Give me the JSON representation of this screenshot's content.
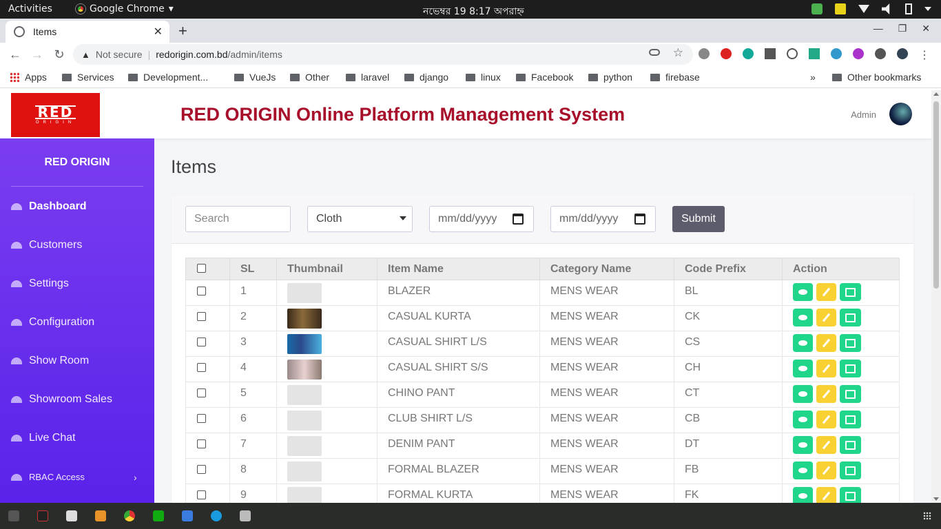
{
  "os": {
    "activities": "Activities",
    "app_menu": "Google Chrome",
    "clock": "নভেম্বর 19   8:17 অপরাহ্ন"
  },
  "browser": {
    "tab_title": "Items",
    "not_secure": "Not secure",
    "url_host": "redorigin.com.bd",
    "url_path": "/admin/items",
    "bookmarks": {
      "apps": "Apps",
      "items": [
        "Services",
        "Development...",
        "VueJs",
        "Other",
        "laravel",
        "django",
        "linux",
        "Facebook",
        "python",
        "firebase"
      ],
      "other": "Other bookmarks",
      "overflow": "»"
    }
  },
  "header": {
    "logo_main": "RED",
    "logo_sub": "ORIGIN",
    "title": "RED ORIGIN Online Platform Management System",
    "user": "Admin"
  },
  "sidebar": {
    "title": "RED ORIGIN",
    "items": [
      {
        "label": "Dashboard"
      },
      {
        "label": "Customers"
      },
      {
        "label": "Settings"
      },
      {
        "label": "Configuration"
      },
      {
        "label": "Show Room"
      },
      {
        "label": "Showroom Sales"
      },
      {
        "label": "Live Chat"
      },
      {
        "label": "RBAC Access"
      }
    ],
    "arrow": "›"
  },
  "main": {
    "page_title": "Items",
    "filters": {
      "search_placeholder": "Search",
      "category_selected": "Cloth",
      "date_from_placeholder": "mm/dd/yyyy",
      "date_to_placeholder": "mm/dd/yyyy",
      "submit_label": "Submit"
    },
    "table": {
      "headers": [
        "SL",
        "Thumbnail",
        "Item Name",
        "Category Name",
        "Code Prefix",
        "Action"
      ],
      "rows": [
        {
          "sl": "1",
          "thumb": "placeholder",
          "name": "BLAZER",
          "category": "MENS WEAR",
          "code": "BL"
        },
        {
          "sl": "2",
          "thumb": "person1",
          "name": "CASUAL KURTA",
          "category": "MENS WEAR",
          "code": "CK"
        },
        {
          "sl": "3",
          "thumb": "person2",
          "name": "CASUAL SHIRT L/S",
          "category": "MENS WEAR",
          "code": "CS"
        },
        {
          "sl": "4",
          "thumb": "person3",
          "name": "CASUAL SHIRT S/S",
          "category": "MENS WEAR",
          "code": "CH"
        },
        {
          "sl": "5",
          "thumb": "placeholder",
          "name": "CHINO PANT",
          "category": "MENS WEAR",
          "code": "CT"
        },
        {
          "sl": "6",
          "thumb": "placeholder",
          "name": "CLUB SHIRT L/S",
          "category": "MENS WEAR",
          "code": "CB"
        },
        {
          "sl": "7",
          "thumb": "placeholder",
          "name": "DENIM PANT",
          "category": "MENS WEAR",
          "code": "DT"
        },
        {
          "sl": "8",
          "thumb": "placeholder",
          "name": "FORMAL BLAZER",
          "category": "MENS WEAR",
          "code": "FB"
        },
        {
          "sl": "9",
          "thumb": "placeholder",
          "name": "FORMAL KURTA",
          "category": "MENS WEAR",
          "code": "FK"
        }
      ]
    }
  },
  "colors": {
    "brand_red": "#e0120f",
    "title_red": "#a70f2a",
    "sidebar_top": "#7a3df0",
    "sidebar_bottom": "#5a22ea",
    "action_green": "#1fd68a",
    "action_yellow": "#fad133",
    "submit_gray": "#5d5c6c"
  }
}
